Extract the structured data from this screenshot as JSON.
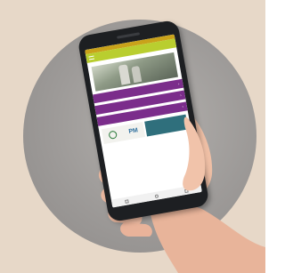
{
  "app": {
    "statusbar_color": "#c9a21a",
    "appbar_color": "#b9ce2f",
    "appbar_title": "",
    "header_title": "",
    "accent_color": "#7b2d8b"
  },
  "menu": {
    "items": [
      {
        "label": "",
        "icon": "chevron-right-icon"
      },
      {
        "label": "",
        "icon": "chevron-right-icon"
      },
      {
        "label": "",
        "icon": "chevron-right-icon"
      }
    ]
  },
  "logos": {
    "left_text": "PM",
    "left_icon": "seal-icon"
  },
  "nav": {
    "buttons": [
      "back-icon",
      "home-icon",
      "recents-icon"
    ]
  }
}
